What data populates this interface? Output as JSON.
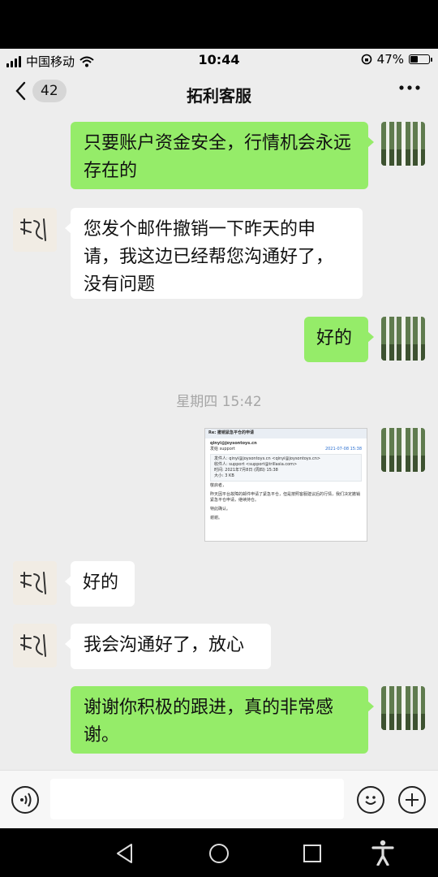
{
  "status_bar": {
    "carrier": "中国移动",
    "time": "10:44",
    "battery_percent": "47%",
    "battery_level": 0.47
  },
  "nav": {
    "unread_count": "42",
    "title": "拓利客服"
  },
  "messages": [
    {
      "side": "right",
      "text": "只要账户资金安全，行情机会永远存在的"
    },
    {
      "side": "left",
      "text": "您发个邮件撤销一下昨天的申请，我这边已经帮您沟通好了，没有问题"
    },
    {
      "side": "right",
      "text": "好的"
    },
    {
      "side": "left",
      "text": "好的"
    },
    {
      "side": "left",
      "text": "我会沟通好了，放心"
    },
    {
      "side": "right",
      "text": "谢谢你积极的跟进，真的非常感谢。"
    }
  ],
  "timestamp": "星期四 15:42",
  "email_screenshot": {
    "subject": "Re: 撤销紧急平仓的申请",
    "from_addr": "qinyi@joysontoys.cn",
    "to_name": "发给 support",
    "date": "2021-07-08 15:38",
    "sender_line": "发件人: qinyi@joysontoys.cn <qinyi@joysontoys.cn>",
    "recipient_line": "收件人: support <support@trillasia.com>",
    "time_line": "时间: 2021年7月8日 (周四) 15:38",
    "size_line": "大小: 3 KB",
    "greeting": "敬启者，",
    "body": "昨天因平台故障的邮件申请了紧急平仓，但是按照客服建议后的行情，我们决定撤销紧急平仓申请，继续持仓。",
    "closing1": "特此确认。",
    "closing2": "谢谢。"
  },
  "icons": {
    "voice": "voice-icon",
    "emoji": "emoji-icon",
    "add": "plus-icon"
  }
}
